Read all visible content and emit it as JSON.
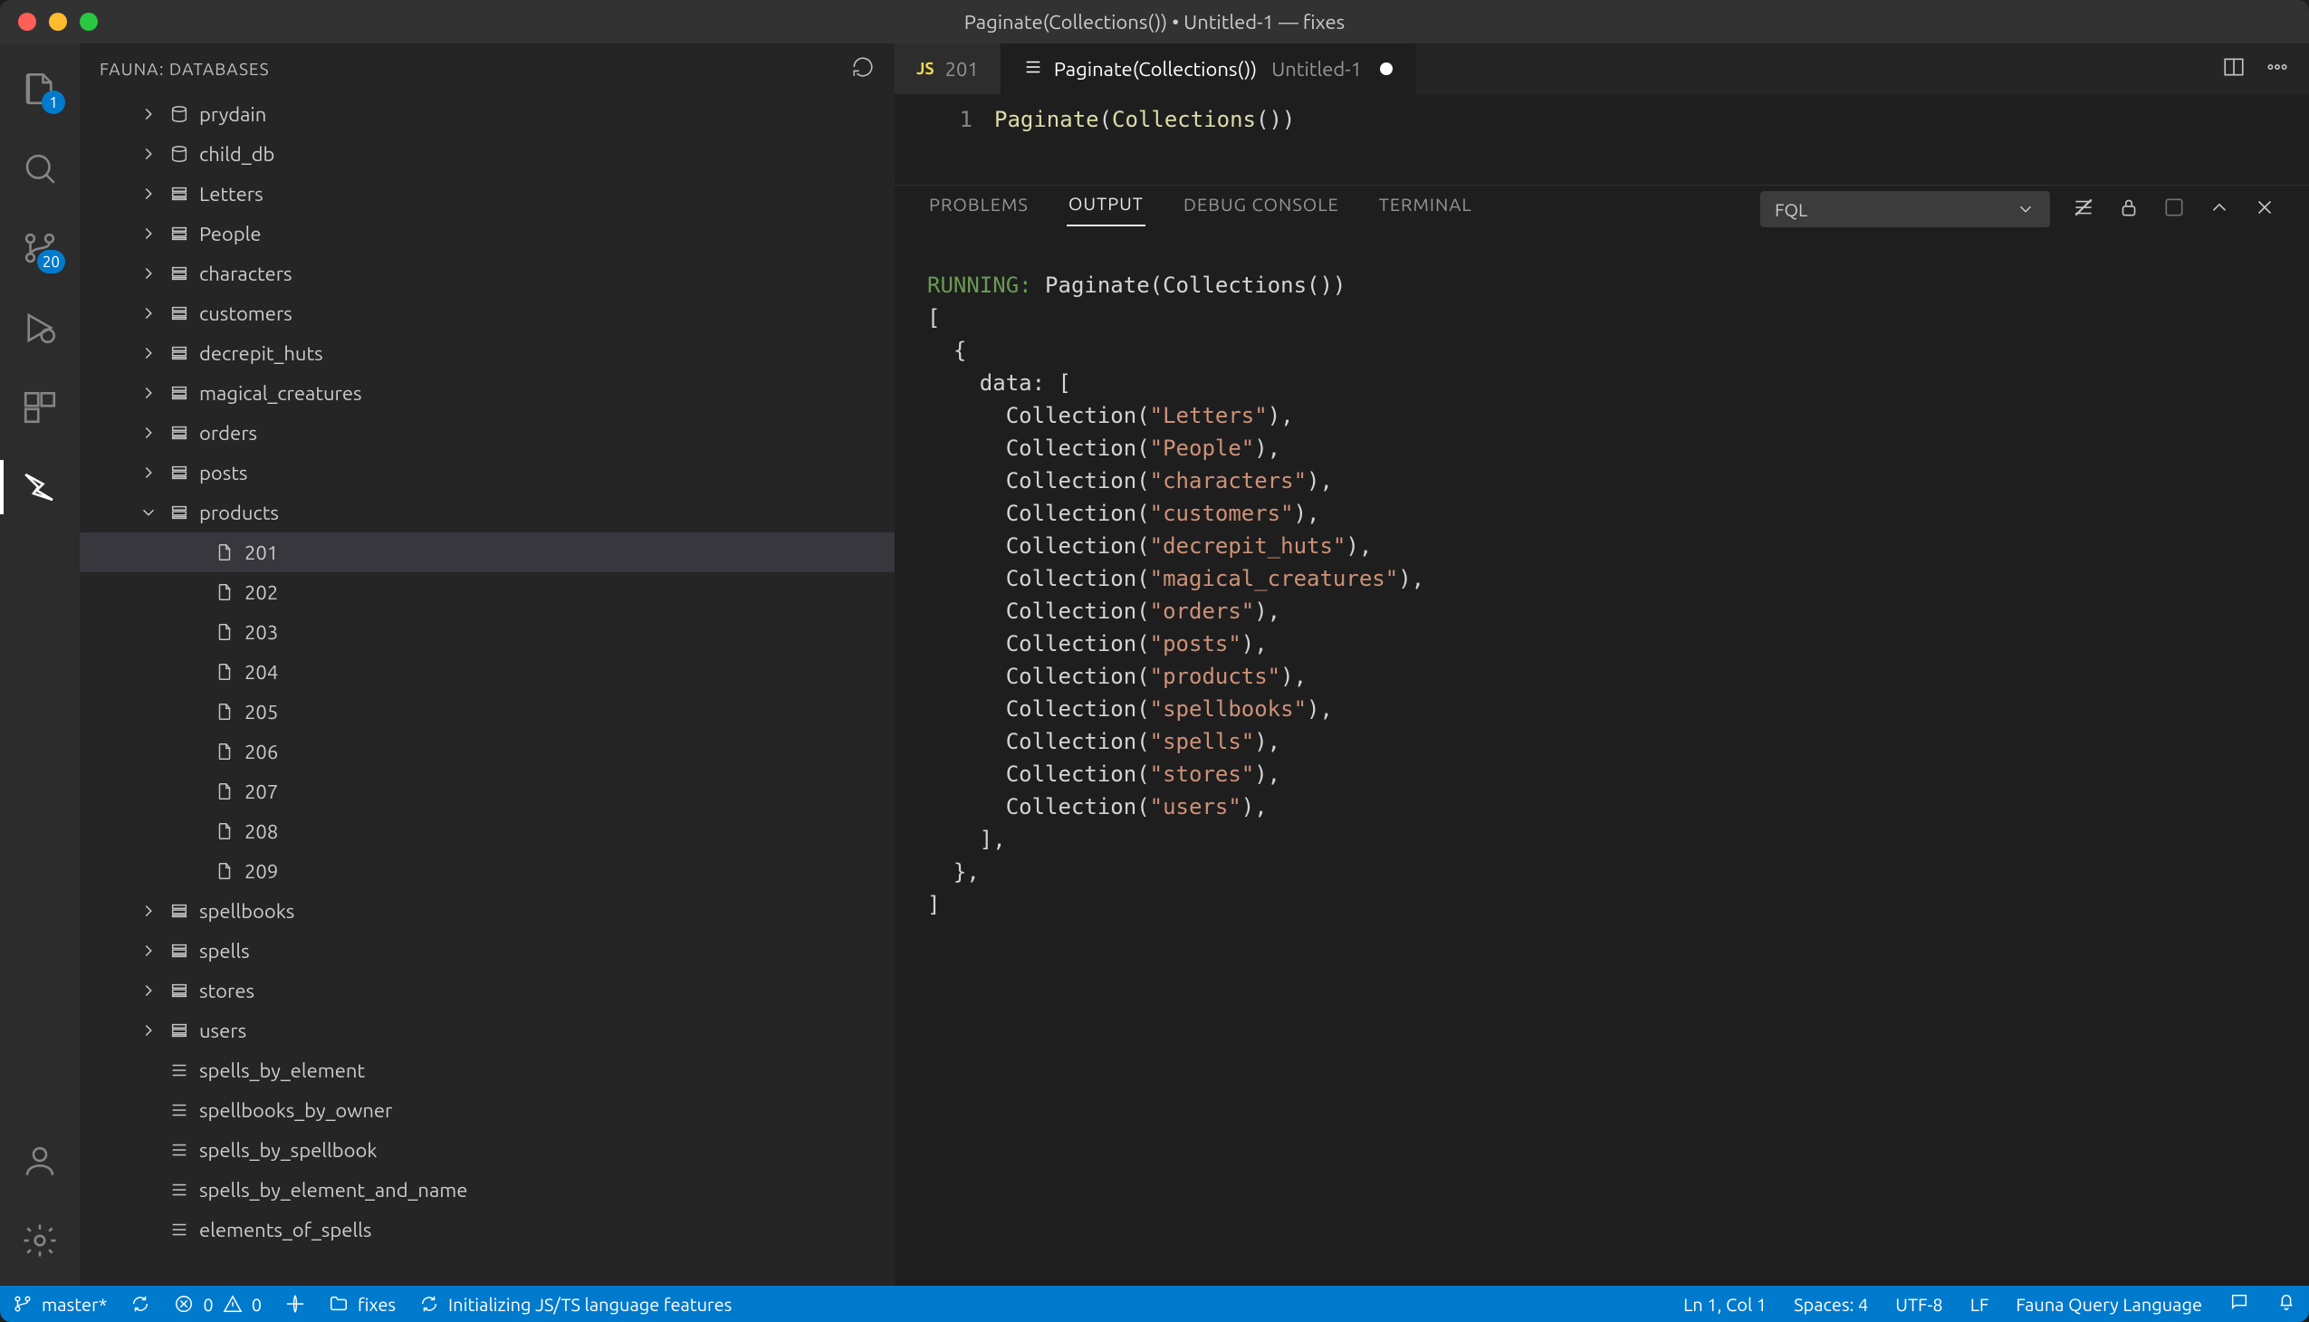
{
  "title": "Paginate(Collections()) • Untitled-1 — fixes",
  "sidebar": {
    "header": "FAUNA: DATABASES",
    "tree": [
      {
        "type": "db",
        "label": "prydain",
        "depth": 1,
        "expand": "right"
      },
      {
        "type": "db",
        "label": "child_db",
        "depth": 1,
        "expand": "right"
      },
      {
        "type": "coll",
        "label": "Letters",
        "depth": 1,
        "expand": "right"
      },
      {
        "type": "coll",
        "label": "People",
        "depth": 1,
        "expand": "right"
      },
      {
        "type": "coll",
        "label": "characters",
        "depth": 1,
        "expand": "right"
      },
      {
        "type": "coll",
        "label": "customers",
        "depth": 1,
        "expand": "right"
      },
      {
        "type": "coll",
        "label": "decrepit_huts",
        "depth": 1,
        "expand": "right"
      },
      {
        "type": "coll",
        "label": "magical_creatures",
        "depth": 1,
        "expand": "right"
      },
      {
        "type": "coll",
        "label": "orders",
        "depth": 1,
        "expand": "right"
      },
      {
        "type": "coll",
        "label": "posts",
        "depth": 1,
        "expand": "right"
      },
      {
        "type": "coll",
        "label": "products",
        "depth": 1,
        "expand": "down"
      },
      {
        "type": "doc",
        "label": "201",
        "depth": 2,
        "selected": true
      },
      {
        "type": "doc",
        "label": "202",
        "depth": 2
      },
      {
        "type": "doc",
        "label": "203",
        "depth": 2
      },
      {
        "type": "doc",
        "label": "204",
        "depth": 2
      },
      {
        "type": "doc",
        "label": "205",
        "depth": 2
      },
      {
        "type": "doc",
        "label": "206",
        "depth": 2
      },
      {
        "type": "doc",
        "label": "207",
        "depth": 2
      },
      {
        "type": "doc",
        "label": "208",
        "depth": 2
      },
      {
        "type": "doc",
        "label": "209",
        "depth": 2
      },
      {
        "type": "coll",
        "label": "spellbooks",
        "depth": 1,
        "expand": "right"
      },
      {
        "type": "coll",
        "label": "spells",
        "depth": 1,
        "expand": "right"
      },
      {
        "type": "coll",
        "label": "stores",
        "depth": 1,
        "expand": "right"
      },
      {
        "type": "coll",
        "label": "users",
        "depth": 1,
        "expand": "right"
      },
      {
        "type": "index",
        "label": "spells_by_element",
        "depth": 1
      },
      {
        "type": "index",
        "label": "spellbooks_by_owner",
        "depth": 1
      },
      {
        "type": "index",
        "label": "spells_by_spellbook",
        "depth": 1
      },
      {
        "type": "index",
        "label": "spells_by_element_and_name",
        "depth": 1
      },
      {
        "type": "index",
        "label": "elements_of_spells",
        "depth": 1
      }
    ]
  },
  "activity": {
    "explorer_badge": "1",
    "scm_badge": "20"
  },
  "tabs": [
    {
      "lang": "JS",
      "label": "201",
      "active": false
    },
    {
      "icon": "list",
      "label": "Paginate(Collections())",
      "title2": "Untitled-1",
      "active": true,
      "dirty": true
    }
  ],
  "editor": {
    "line_no": "1",
    "code": {
      "fn1": "Paginate",
      "fn2": "Collections"
    }
  },
  "panel": {
    "tabs": {
      "problems": "PROBLEMS",
      "output": "OUTPUT",
      "debug": "DEBUG CONSOLE",
      "terminal": "TERMINAL"
    },
    "select": "FQL",
    "running_label": "RUNNING:",
    "running_cmd": "Paginate(Collections())",
    "collections": [
      "Letters",
      "People",
      "characters",
      "customers",
      "decrepit_huts",
      "magical_creatures",
      "orders",
      "posts",
      "products",
      "spellbooks",
      "spells",
      "stores",
      "users"
    ]
  },
  "status": {
    "branch": "master*",
    "errors": "0",
    "warnings": "0",
    "folder": "fixes",
    "task": "Initializing JS/TS language features",
    "lncol": "Ln 1, Col 1",
    "spaces": "Spaces: 4",
    "encoding": "UTF-8",
    "eol": "LF",
    "language": "Fauna Query Language"
  }
}
